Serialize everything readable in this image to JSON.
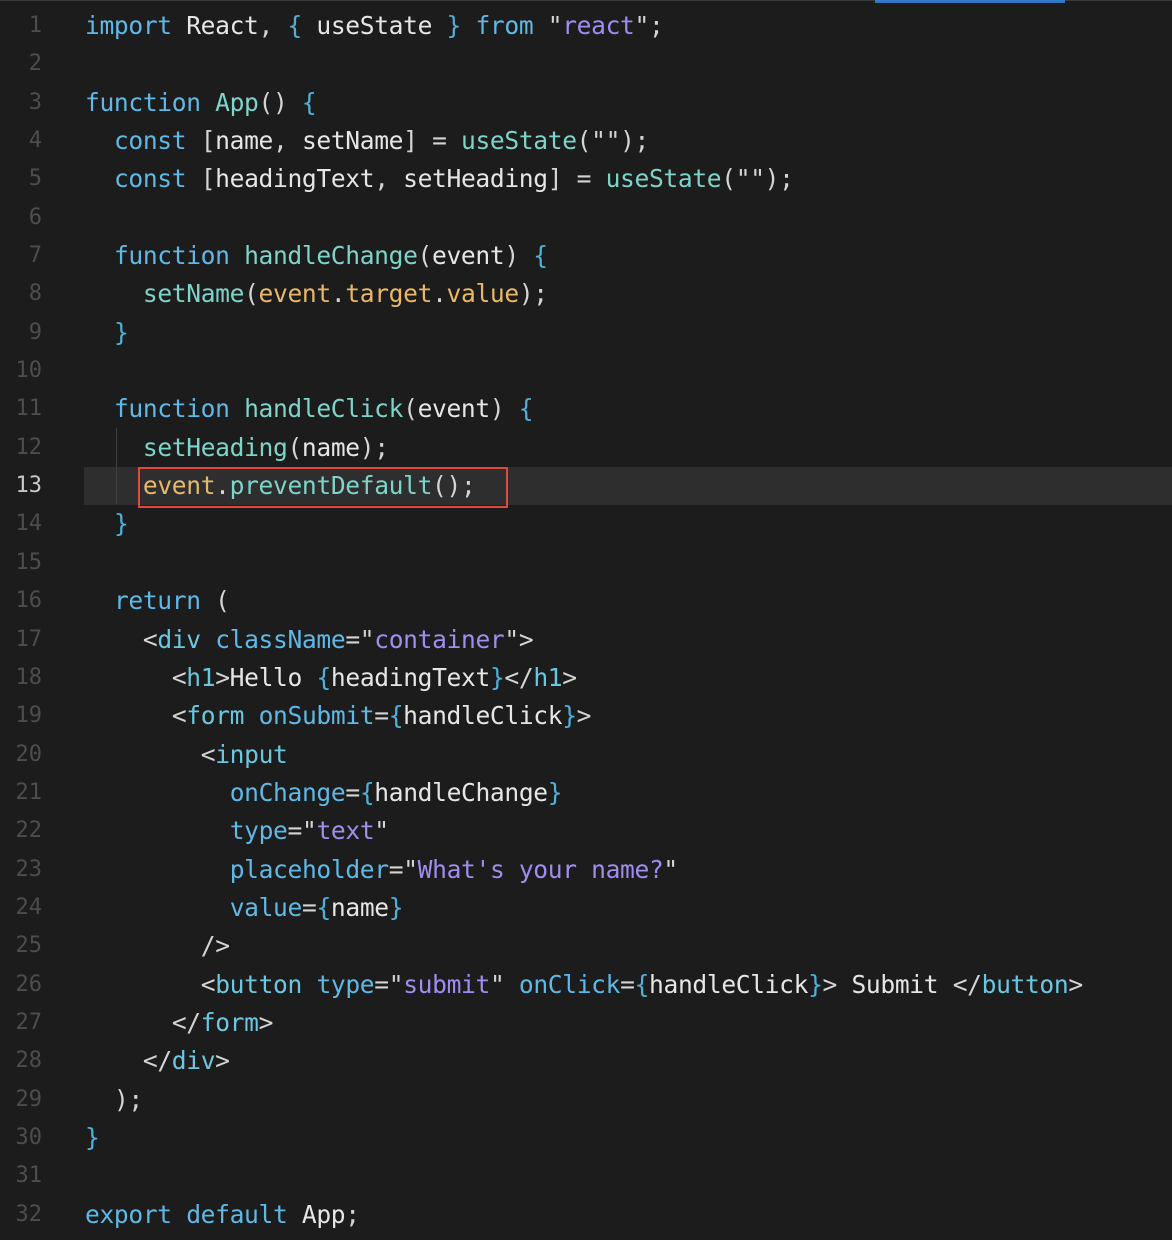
{
  "editor": {
    "current_line": 13,
    "highlighted_statement": "event.preventDefault();",
    "lines": [
      {
        "n": "1",
        "text": "import React, { useState } from \"react\";"
      },
      {
        "n": "2",
        "text": ""
      },
      {
        "n": "3",
        "text": "function App() {"
      },
      {
        "n": "4",
        "text": "  const [name, setName] = useState(\"\");"
      },
      {
        "n": "5",
        "text": "  const [headingText, setHeading] = useState(\"\");"
      },
      {
        "n": "6",
        "text": ""
      },
      {
        "n": "7",
        "text": "  function handleChange(event) {"
      },
      {
        "n": "8",
        "text": "    setName(event.target.value);"
      },
      {
        "n": "9",
        "text": "  }"
      },
      {
        "n": "10",
        "text": ""
      },
      {
        "n": "11",
        "text": "  function handleClick(event) {"
      },
      {
        "n": "12",
        "text": "    setHeading(name);"
      },
      {
        "n": "13",
        "text": "    event.preventDefault();"
      },
      {
        "n": "14",
        "text": "  }"
      },
      {
        "n": "15",
        "text": ""
      },
      {
        "n": "16",
        "text": "  return ("
      },
      {
        "n": "17",
        "text": "    <div className=\"container\">"
      },
      {
        "n": "18",
        "text": "      <h1>Hello {headingText}</h1>"
      },
      {
        "n": "19",
        "text": "      <form onSubmit={handleClick}>"
      },
      {
        "n": "20",
        "text": "        <input"
      },
      {
        "n": "21",
        "text": "          onChange={handleChange}"
      },
      {
        "n": "22",
        "text": "          type=\"text\""
      },
      {
        "n": "23",
        "text": "          placeholder=\"What's your name?\""
      },
      {
        "n": "24",
        "text": "          value={name}"
      },
      {
        "n": "25",
        "text": "        />"
      },
      {
        "n": "26",
        "text": "        <button type=\"submit\" onClick={handleClick}> Submit </button>"
      },
      {
        "n": "27",
        "text": "      </form>"
      },
      {
        "n": "28",
        "text": "    </div>"
      },
      {
        "n": "29",
        "text": "  );"
      },
      {
        "n": "30",
        "text": "}"
      },
      {
        "n": "31",
        "text": ""
      },
      {
        "n": "32",
        "text": "export default App;"
      }
    ]
  },
  "colors": {
    "background": "#1c1c1c",
    "current_line_bg": "#2e2e2e",
    "highlight_border": "#e0483a",
    "active_tab": "#3794ff"
  }
}
